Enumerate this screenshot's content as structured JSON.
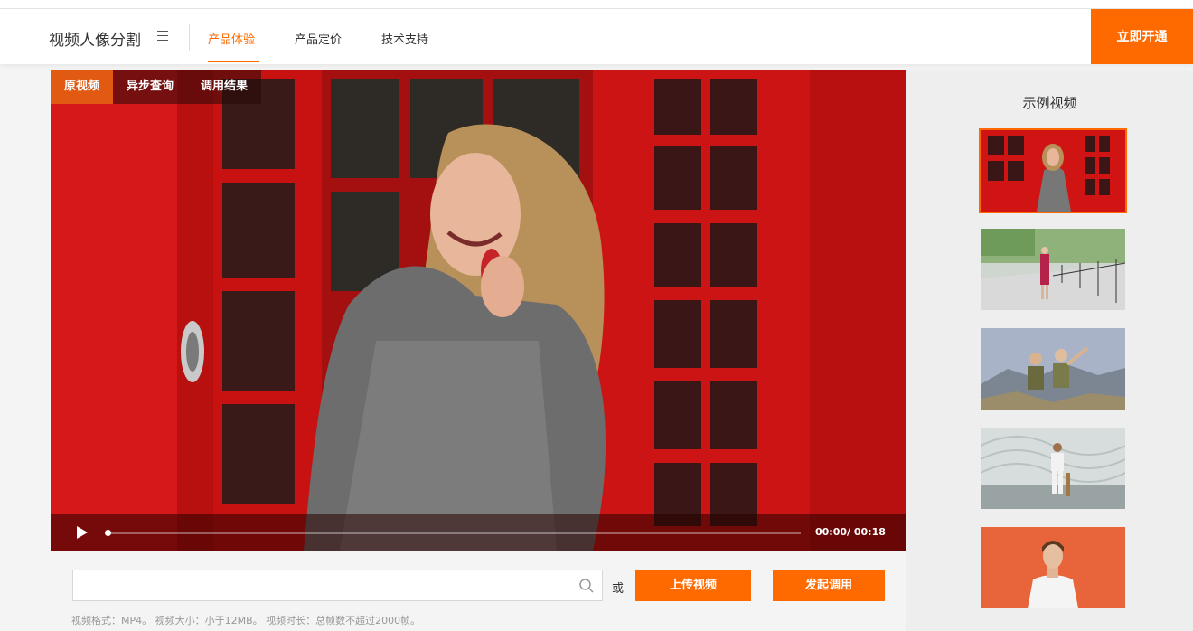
{
  "header": {
    "brand": "视频人像分割",
    "nav": [
      {
        "label": "产品体验",
        "active": true
      },
      {
        "label": "产品定价",
        "active": false
      },
      {
        "label": "技术支持",
        "active": false
      }
    ],
    "cta_label": "立即开通"
  },
  "player": {
    "tabs": [
      {
        "label": "原视频",
        "active": true
      },
      {
        "label": "异步查询",
        "active": false
      },
      {
        "label": "调用结果",
        "active": false
      }
    ],
    "time": "00:00/ 00:18",
    "progress": 0
  },
  "sidebar": {
    "title": "示例视频",
    "selected_index": 0
  },
  "upload": {
    "input_value": "",
    "input_placeholder": "",
    "or_text": "或",
    "upload_label": "上传视频",
    "invoke_label": "发起调用",
    "hint": "视频格式：MP4。 视频大小：小于12MB。 视频时长：总帧数不超过2000帧。"
  },
  "colors": {
    "accent": "#ff6a00",
    "booth_red": "#d81414"
  }
}
